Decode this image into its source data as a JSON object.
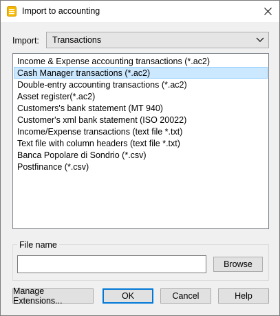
{
  "window": {
    "title": "Import to accounting",
    "close_symbol": "✕",
    "icon": "banana-app-icon"
  },
  "import_row": {
    "label": "Import:",
    "selected_value": "Transactions"
  },
  "list": {
    "selected_index": 1,
    "items": [
      "Income & Expense accounting transactions (*.ac2)",
      "Cash Manager transactions (*.ac2)",
      "Double-entry accounting transactions (*.ac2)",
      "Asset register(*.ac2)",
      "Customers's bank statement (MT 940)",
      "Customer's xml bank statement (ISO 20022)",
      "Income/Expense transactions (text file *.txt)",
      "Text file with column headers (text file *.txt)",
      "Banca Popolare di Sondrio (*.csv)",
      "Postfinance (*.csv)"
    ]
  },
  "file_group": {
    "label": "File name",
    "value": "",
    "browse_label": "Browse"
  },
  "footer": {
    "extensions_label": "Manage Extensions...",
    "ok_label": "OK",
    "cancel_label": "Cancel",
    "help_label": "Help"
  },
  "colors": {
    "selection_bg": "#cce8ff",
    "selection_border": "#99d1ff",
    "default_button_border": "#0078d7",
    "app_icon": "#f5b800"
  }
}
